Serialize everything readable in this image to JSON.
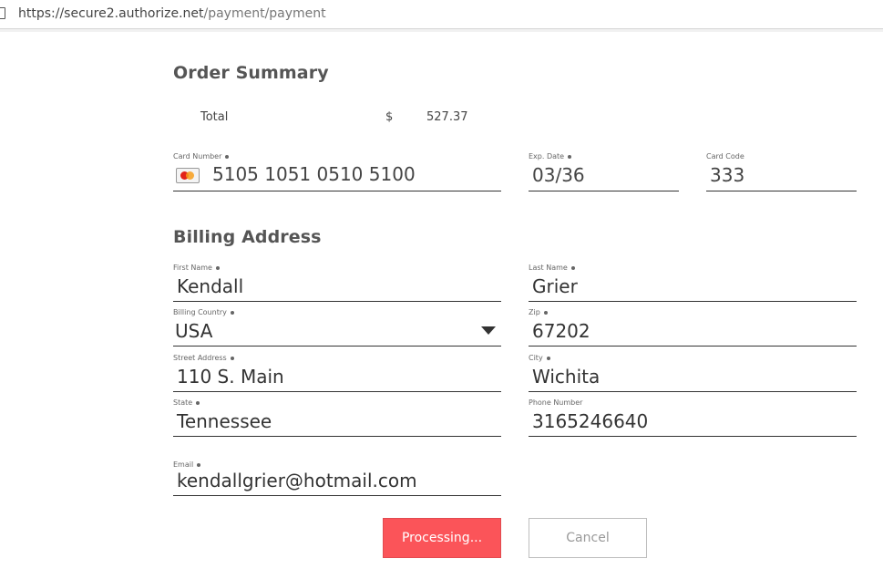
{
  "browser": {
    "url_host": "https://secure2.authorize.net",
    "url_path": "/payment/payment"
  },
  "order_summary": {
    "title": "Order Summary",
    "total_label": "Total",
    "currency": "$",
    "amount": "527.37"
  },
  "card": {
    "number_label": "Card Number",
    "number_value": "5105 1051 0510 5100",
    "exp_label": "Exp. Date",
    "exp_value": "03/36",
    "code_label": "Card Code",
    "code_value": "333",
    "brand_icon": "mastercard-icon"
  },
  "billing": {
    "title": "Billing Address",
    "first_name_label": "First Name",
    "first_name_value": "Kendall",
    "last_name_label": "Last Name",
    "last_name_value": "Grier",
    "country_label": "Billing Country",
    "country_value": "USA",
    "zip_label": "Zip",
    "zip_value": "67202",
    "street_label": "Street Address",
    "street_value": "110 S. Main",
    "city_label": "City",
    "city_value": "Wichita",
    "state_label": "State",
    "state_value": "Tennessee",
    "phone_label": "Phone Number",
    "phone_value": "3165246640",
    "email_label": "Email",
    "email_value": "kendallgrier@hotmail.com"
  },
  "actions": {
    "submit_label": "Processing...",
    "cancel_label": "Cancel"
  },
  "colors": {
    "submit_bg": "#fb5459",
    "cancel_text": "#999999"
  }
}
